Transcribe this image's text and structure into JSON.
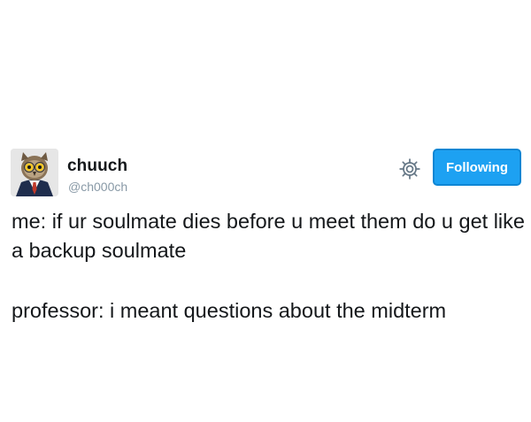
{
  "user": {
    "display_name": "chuuch",
    "handle": "@ch000ch"
  },
  "actions": {
    "follow_label": "Following",
    "settings_icon": "gear-icon"
  },
  "tweet": {
    "paragraphs": [
      "me: if ur soulmate dies before u meet them do u get like a backup soulmate",
      "professor: i meant questions about the midterm"
    ]
  },
  "colors": {
    "accent": "#1da1f2",
    "text": "#14171a",
    "muted": "#8899a6"
  }
}
